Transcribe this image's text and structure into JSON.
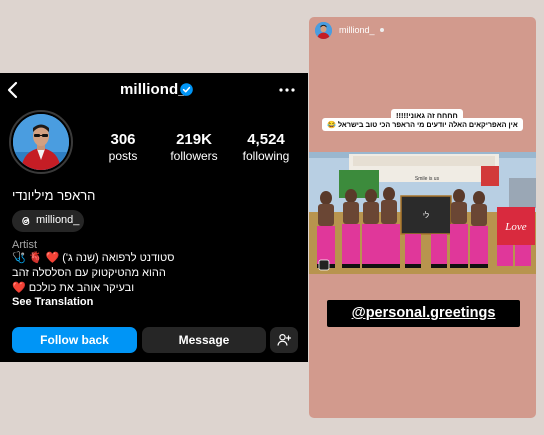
{
  "profile": {
    "username": "milliond_",
    "stats": {
      "posts": {
        "value": "306",
        "label": "posts"
      },
      "followers": {
        "value": "219K",
        "label": "followers"
      },
      "following": {
        "value": "4,524",
        "label": "following"
      }
    },
    "display_name": "הראפר מיליונדי",
    "threads_handle": "milliond_",
    "category": "Artist",
    "bio_lines": [
      "סטודנט לרפואה (שנה ג') ❤️ 🫀 🩺",
      "ההוא מהטיקטוק עם הסלסלה זהב",
      "ובעיקר אוהב את כולכם ❤️"
    ],
    "see_translation": "See Translation",
    "buttons": {
      "follow": "Follow back",
      "message": "Message"
    },
    "icons": [
      "back-icon",
      "verified-icon",
      "more-icon",
      "threads-icon",
      "add-user-icon"
    ],
    "colors": {
      "follow_button": "#0095f6",
      "verified": "#0095f6"
    }
  },
  "story": {
    "username": "milliond_",
    "captions": [
      "חחחח זה גאוני!!!!!",
      "אין האפריקאים האלה יודעים מי הראפר הכי טוב בישראל 😂"
    ],
    "photo_blackboard_text": "לי",
    "photo_love_sign": "Love",
    "photo_banner_text": "Smile is us",
    "mention": "@personal.greetings"
  }
}
